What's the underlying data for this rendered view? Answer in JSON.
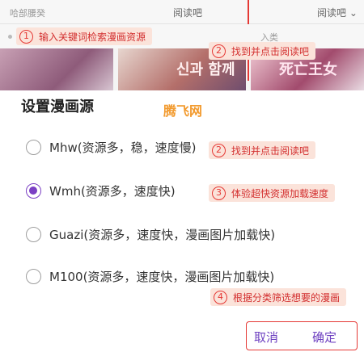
{
  "background": {
    "top_left_text": "哈部腰癸",
    "read_tab_left": "阅读吧",
    "read_tab_right": "阅读吧 ⌄",
    "category_text": "入类",
    "cover_title_b": "신과 함께",
    "cover_title_c": "死亡王女"
  },
  "dialog": {
    "title": "设置漫画源",
    "watermark": "腾飞网",
    "options": [
      {
        "label": "Mhw(资源多，稳，速度慢)",
        "selected": false
      },
      {
        "label": "Wmh(资源多，速度快)",
        "selected": true
      },
      {
        "label": "Guazi(资源多，速度快，漫画图片加载快)",
        "selected": false
      },
      {
        "label": "M100(资源多，速度快，漫画图片加载快)",
        "selected": false
      }
    ],
    "cancel_label": "取消",
    "ok_label": "确定",
    "accent_color": "#7b3fc4"
  },
  "callouts": [
    {
      "num": "1",
      "text": "输入关键词检索漫画资源"
    },
    {
      "num": "2",
      "text": "找到并点击阅读吧"
    },
    {
      "num": "2",
      "text": "找到并点击阅读吧"
    },
    {
      "num": "3",
      "text": "体验超快资源加载速度"
    },
    {
      "num": "4",
      "text": "根据分类筛选想要的漫画"
    }
  ]
}
